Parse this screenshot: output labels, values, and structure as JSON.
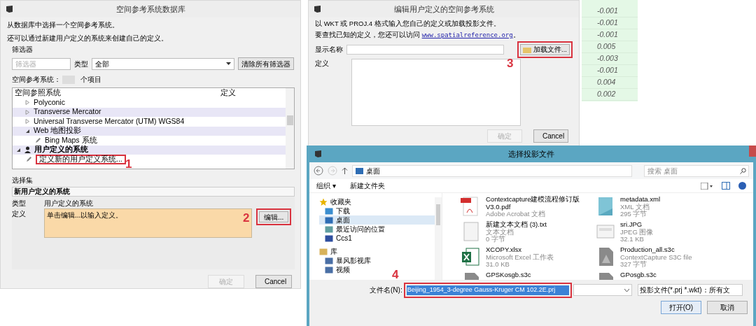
{
  "db_dialog": {
    "title": "空间参考系统数据库",
    "intro": [
      "从数据库中选择一个空间参考系统。",
      "还可以通过新建用户定义的系统来创建自己的定义。"
    ],
    "filter": {
      "group_label": "筛选器",
      "placeholder": "筛选器",
      "type_label": "类型",
      "type_value": "全部",
      "clear_button": "清除所有筛选器"
    },
    "count": {
      "label": "空间参考系统：",
      "unit": "个项目"
    },
    "tree": {
      "columns": [
        "空间参照系统",
        "定义"
      ],
      "scrolled_branch": [
        {
          "label": "Polyconic",
          "expanded": false
        },
        {
          "label": "Transverse Mercator",
          "expanded": false
        },
        {
          "label": "Universal Transverse Mercator (UTM) WGS84",
          "expanded": false
        },
        {
          "label": "Web 地图投影",
          "expanded": true,
          "children": [
            {
              "label": "Bing Maps 系统"
            }
          ]
        }
      ],
      "items": [
        {
          "label": "用户定义的系统",
          "expanded": true,
          "children": [
            {
              "label": "定义新的用户定义系统..."
            }
          ]
        }
      ]
    },
    "selection": {
      "group_label": "选择集",
      "name": "新用户定义的系统",
      "type_label": "类型",
      "type_value": "用户定义的系统",
      "def_label": "定义",
      "def_hint": "单击编辑...以输入定义。",
      "edit_button": "编辑..."
    },
    "buttons": [
      {
        "label": "确定",
        "disabled": true
      },
      {
        "label": "Cancel",
        "disabled": false
      }
    ]
  },
  "edit_dialog": {
    "title": "编辑用户定义的空间参考系统",
    "intro": "以 WKT 或 PROJ.4 格式输入您自己的定义或加载投影文件。",
    "lookup_text": "要查找已知的定义，您还可以访问",
    "link": "www.spatialreference.org",
    "link_suffix": "。",
    "name_label": "显示名称",
    "load_button": "加载文件...",
    "def_label": "定义",
    "buttons": [
      {
        "label": "确定",
        "disabled": true
      },
      {
        "label": "Cancel",
        "disabled": false
      }
    ]
  },
  "sheet_cells": [
    "-0.001",
    "-0.001",
    "-0.001",
    "0.005",
    "-0.003",
    "-0.001",
    "0.004",
    "0.002"
  ],
  "file_dialog": {
    "title": "选择投影文件",
    "breadcrumb": "桌面",
    "search_placeholder": "搜索 桌面",
    "toolbar": [
      "组织 ▾",
      "新建文件夹"
    ],
    "sidebar": [
      {
        "label": "收藏夹",
        "kind": "star",
        "children": [
          {
            "label": "下载",
            "kind": "download",
            "selected": false
          },
          {
            "label": "桌面",
            "kind": "desktop",
            "selected": true
          },
          {
            "label": "最近访问的位置",
            "kind": "recent",
            "selected": false
          },
          {
            "label": "Ccs1",
            "kind": "user",
            "selected": false
          }
        ]
      },
      {
        "label": "库",
        "kind": "library",
        "children": [
          {
            "label": "暴风影视库",
            "kind": "video",
            "selected": false
          },
          {
            "label": "视频",
            "kind": "video",
            "selected": false
          }
        ]
      }
    ],
    "files": [
      {
        "name": "Contextcapture建模流程修订版 V3.0.pdf",
        "kind": "pdf",
        "type": "Adobe Acrobat 文档"
      },
      {
        "name": "metadata.xml",
        "kind": "xml",
        "type": "XML 文档",
        "size": "295 字节"
      },
      {
        "name": "新建文本文档 (3).txt",
        "kind": "txt",
        "type": "文本文档",
        "size": "0 字节"
      },
      {
        "name": "sri.JPG",
        "kind": "jpg",
        "type": "JPEG 图像",
        "size": "32.1 KB"
      },
      {
        "name": "XCOPY.xlsx",
        "kind": "xlsx",
        "type": "Microsoft Excel 工作表",
        "size": "31.0 KB"
      },
      {
        "name": "Production_all.s3c",
        "kind": "s3c",
        "type": "ContextCapture S3C file",
        "size": "327 字节"
      },
      {
        "name": "GPSKosgb.s3c",
        "kind": "s3c"
      },
      {
        "name": "GPosgb.s3c",
        "kind": "s3c"
      }
    ],
    "filename_label": "文件名(N):",
    "filename": "Beijing_1954_3-degree Gauss-Kruger CM 102.2E.prj",
    "filter": "投影文件(*.prj *.wkt)：所有文",
    "open_button": "打开(O)",
    "cancel_button": "取消"
  },
  "callouts": [
    "1",
    "2",
    "3",
    "4"
  ]
}
